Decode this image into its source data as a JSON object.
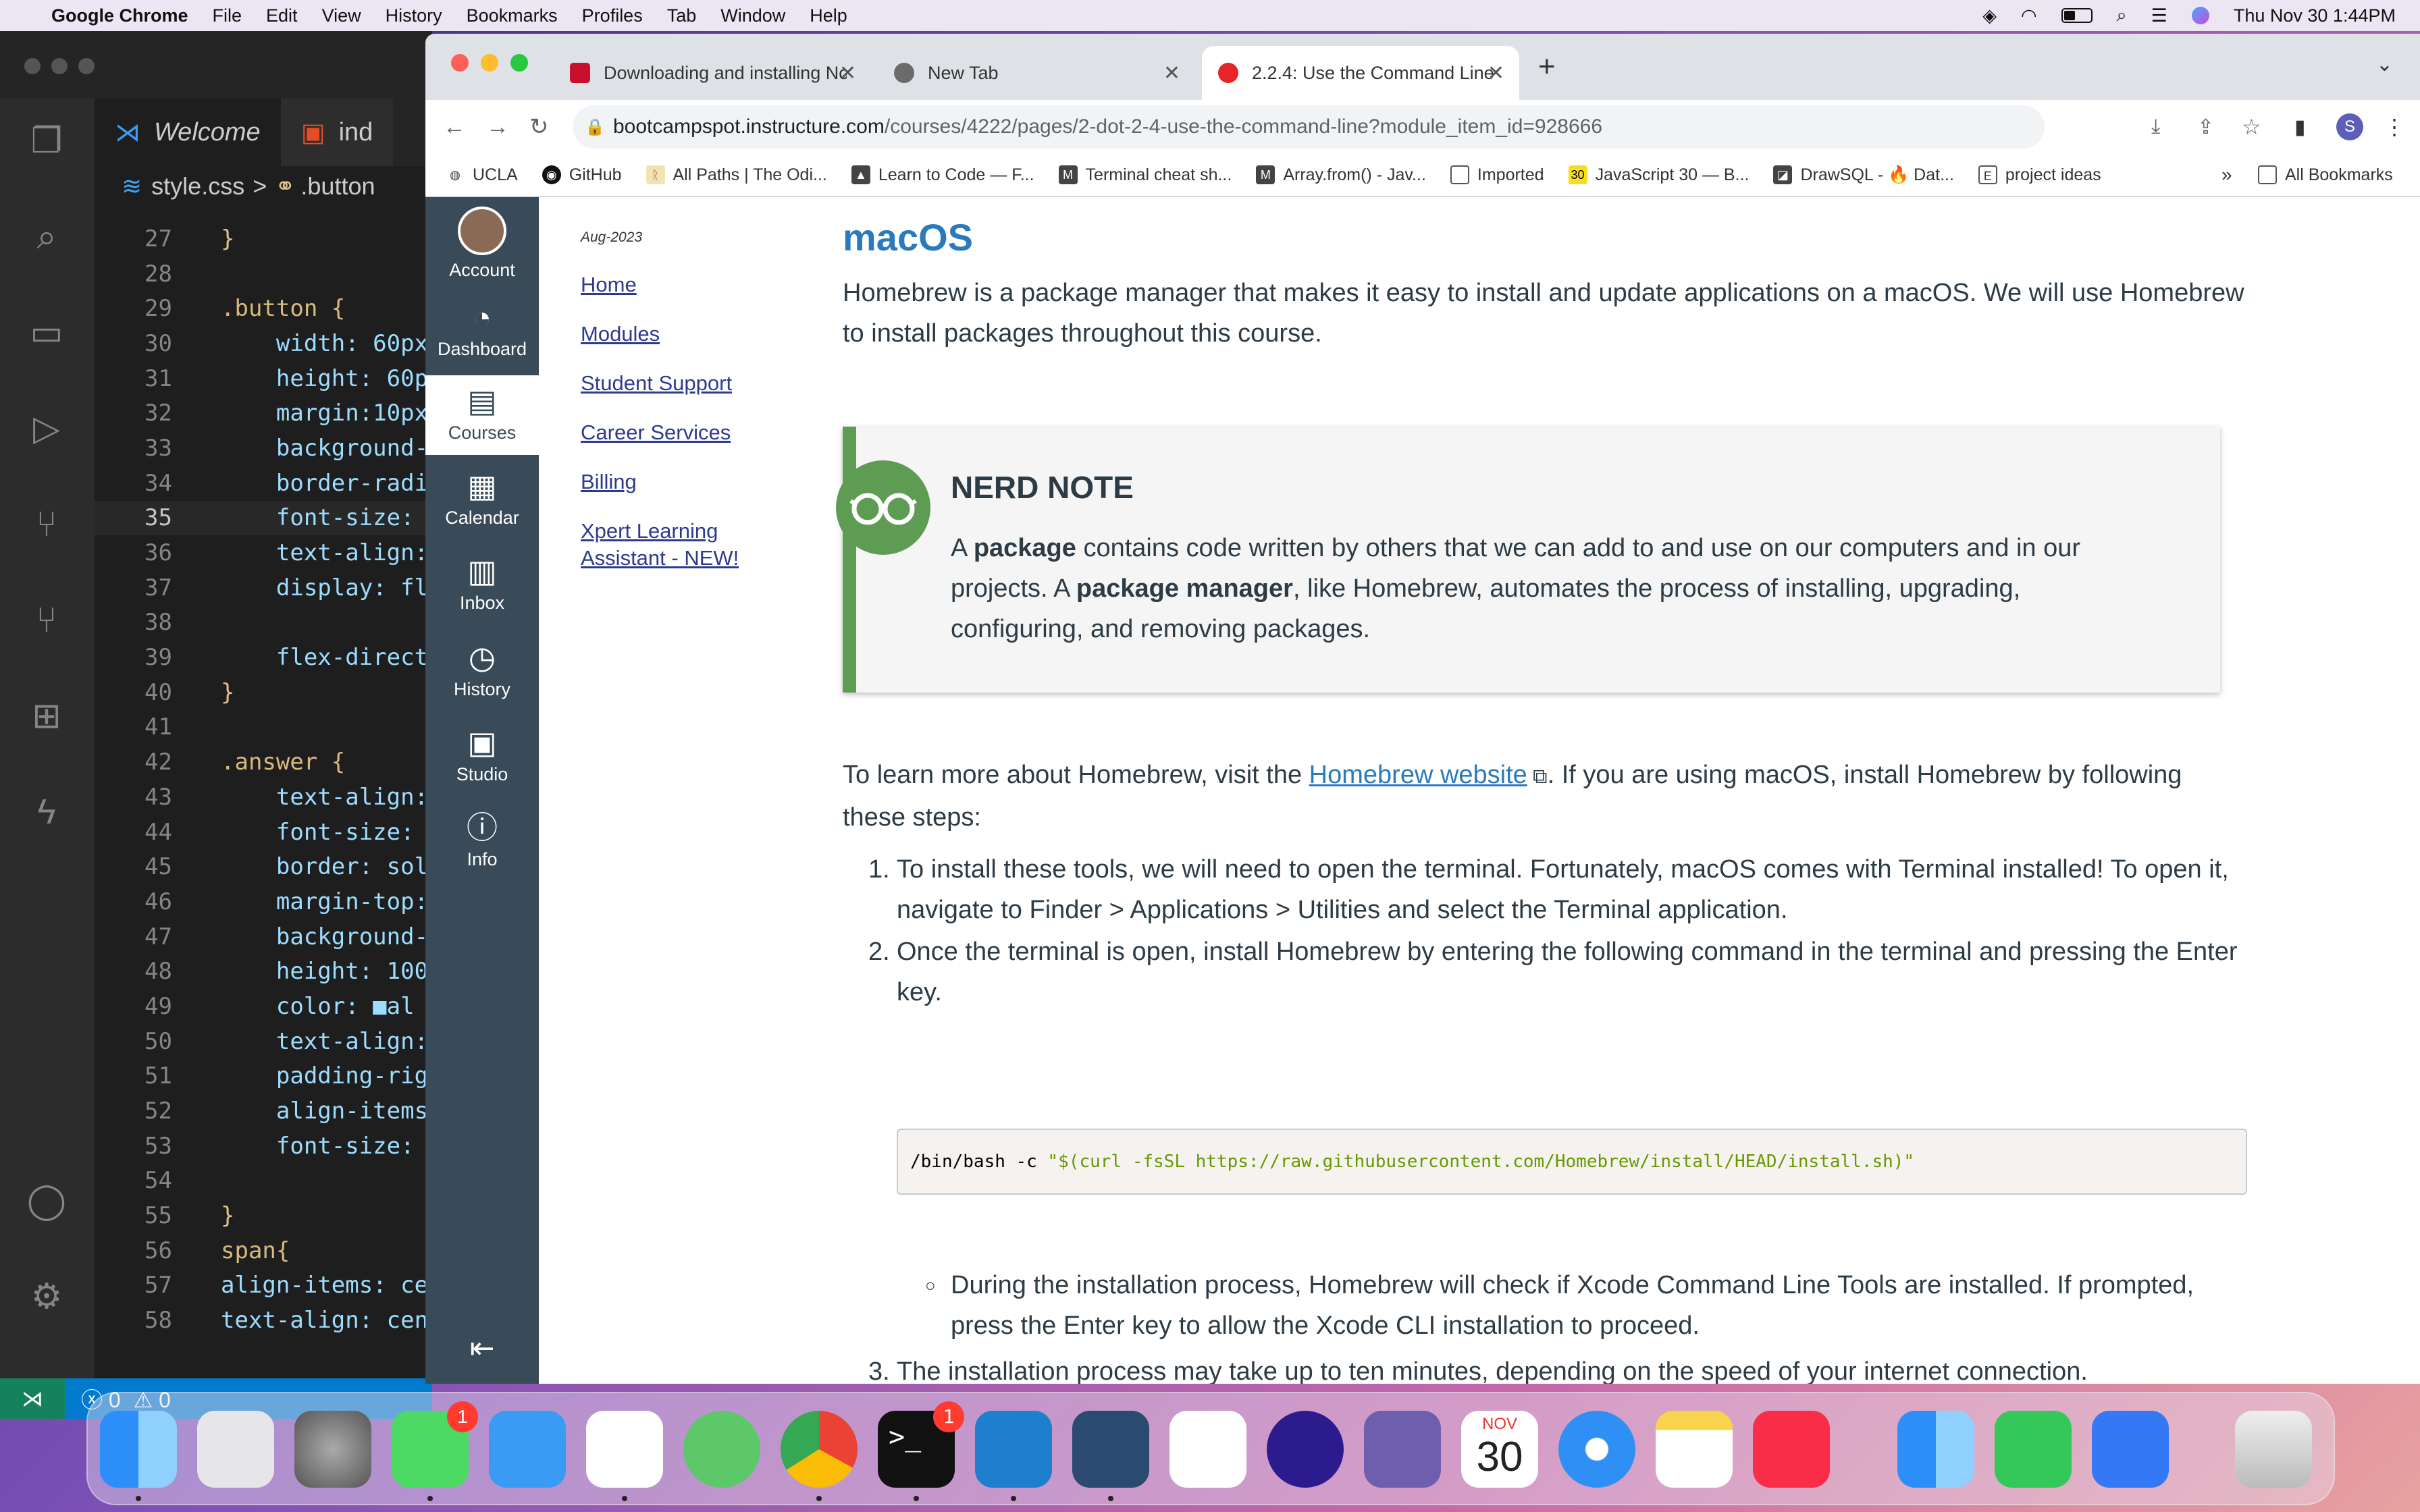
{
  "menubar": {
    "app": "Google Chrome",
    "items": [
      "File",
      "Edit",
      "View",
      "History",
      "Bookmarks",
      "Profiles",
      "Tab",
      "Window",
      "Help"
    ],
    "datetime": "Thu Nov 30  1:44PM"
  },
  "vscode": {
    "tabs": [
      {
        "label": "Welcome"
      },
      {
        "label": "ind"
      }
    ],
    "breadcrumb": {
      "file": "style.css",
      "separator": ">",
      "symbol": ".button"
    },
    "lines": [
      {
        "n": "27",
        "t": "}"
      },
      {
        "n": "28",
        "t": ""
      },
      {
        "n": "29",
        "t": ".button {"
      },
      {
        "n": "30",
        "t": "    width: 60px"
      },
      {
        "n": "31",
        "t": "    height: 60p"
      },
      {
        "n": "32",
        "t": "    margin:10px"
      },
      {
        "n": "33",
        "t": "    background-"
      },
      {
        "n": "34",
        "t": "    border-radi"
      },
      {
        "n": "35",
        "t": "    font-size:"
      },
      {
        "n": "36",
        "t": "    text-align:"
      },
      {
        "n": "37",
        "t": "    display: fl"
      },
      {
        "n": "38",
        "t": ""
      },
      {
        "n": "39",
        "t": "    flex-direct"
      },
      {
        "n": "40",
        "t": "}"
      },
      {
        "n": "41",
        "t": ""
      },
      {
        "n": "42",
        "t": ".answer {"
      },
      {
        "n": "43",
        "t": "    text-align:"
      },
      {
        "n": "44",
        "t": "    font-size:"
      },
      {
        "n": "45",
        "t": "    border: sol"
      },
      {
        "n": "46",
        "t": "    margin-top:"
      },
      {
        "n": "47",
        "t": "    background-"
      },
      {
        "n": "48",
        "t": "    height: 100"
      },
      {
        "n": "49",
        "t": "    color: ■al"
      },
      {
        "n": "50",
        "t": "    text-align:"
      },
      {
        "n": "51",
        "t": "    padding-rig"
      },
      {
        "n": "52",
        "t": "    align-items"
      },
      {
        "n": "53",
        "t": "    font-size:"
      },
      {
        "n": "54",
        "t": ""
      },
      {
        "n": "55",
        "t": "}"
      },
      {
        "n": "56",
        "t": "span{"
      },
      {
        "n": "57",
        "t": "align-items: ce"
      },
      {
        "n": "58",
        "t": "text-align: cen"
      }
    ],
    "status": {
      "errors": "0",
      "warnings": "0"
    }
  },
  "chrome": {
    "tabs": [
      {
        "label": "Downloading and installing No"
      },
      {
        "label": "New Tab"
      },
      {
        "label": "2.2.4: Use the Command Line"
      }
    ],
    "url_host": "bootcampspot.instructure.com",
    "url_path": "/courses/4222/pages/2-dot-2-4-use-the-command-line?module_item_id=928666",
    "profile": "S",
    "bookmarks": [
      "UCLA",
      "GitHub",
      "All Paths | The Odi...",
      "Learn to Code — F...",
      "Terminal cheat sh...",
      "Array.from() - Jav...",
      "Imported",
      "JavaScript 30 — B...",
      "DrawSQL - 🔥 Dat...",
      "project ideas"
    ],
    "all_bookmarks": "All Bookmarks"
  },
  "canvas_nav": [
    {
      "label": "Account",
      "icon": "avatar"
    },
    {
      "label": "Dashboard",
      "icon": "dashboard-icon"
    },
    {
      "label": "Courses",
      "icon": "courses-icon"
    },
    {
      "label": "Calendar",
      "icon": "calendar-icon"
    },
    {
      "label": "Inbox",
      "icon": "inbox-icon"
    },
    {
      "label": "History",
      "icon": "history-icon"
    },
    {
      "label": "Studio",
      "icon": "studio-icon"
    },
    {
      "label": "Info",
      "icon": "info-icon"
    }
  ],
  "course_nav": {
    "term": "Aug-2023",
    "links": [
      "Home",
      "Modules",
      "Student Support",
      "Career Services",
      "Billing",
      "Xpert Learning Assistant - NEW!"
    ]
  },
  "content": {
    "heading": "macOS",
    "intro": "Homebrew is a package manager that makes it easy to install and update applications on a macOS. We will use Homebrew to install packages throughout this course.",
    "note_title": "NERD NOTE",
    "note_p1": "A ",
    "note_b1": "package",
    "note_p2": " contains code written by others that we can add to and use on our computers and in our projects. A ",
    "note_b2": "package manager",
    "note_p3": ", like Homebrew, automates the process of installing, upgrading, configuring, and removing packages.",
    "learn_pre": "To learn more about Homebrew, visit the ",
    "learn_link": "Homebrew website",
    "learn_post": ". If you are using macOS, install Homebrew by following these steps:",
    "steps": [
      "To install these tools, we will need to open the terminal. Fortunately, macOS comes with Terminal installed! To open it, navigate to Finder > Applications > Utilities and select the Terminal application.",
      "Once the terminal is open, install Homebrew by entering the following command in the terminal and pressing the Enter key.",
      "The installation process may take up to ten minutes, depending on the speed of your internet connection."
    ],
    "code_cmd": "/bin/bash -c ",
    "code_str": "\"$(curl -fsSL https://raw.githubusercontent.com/Homebrew/install/HEAD/install.sh)\"",
    "sub_bullet": "During the installation process, Homebrew will check if Xcode Command Line Tools are installed. If prompted, press the Enter key to allow the Xcode CLI installation to proceed."
  },
  "dock": {
    "messages_badge": "1",
    "terminal_badge": "1",
    "calendar_month": "NOV",
    "calendar_day": "30"
  },
  "colors": {
    "canvas_nav": "#394b58",
    "link": "#2b7abc",
    "note_green": "#5e9c53"
  }
}
